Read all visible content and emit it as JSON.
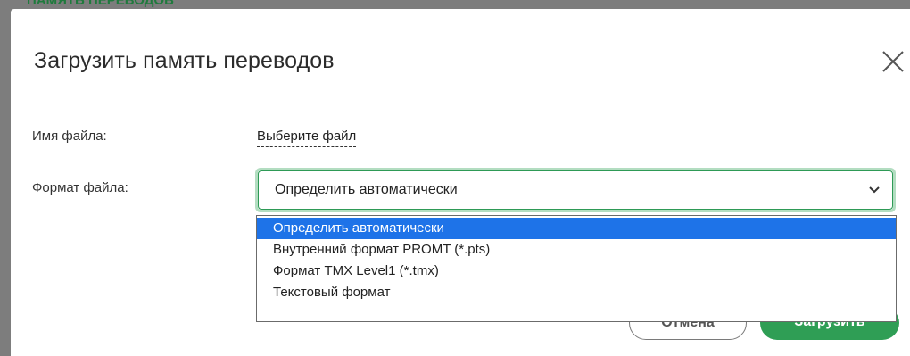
{
  "background": {
    "heading": "ПАМЯТЬ ПЕРЕВОДОВ"
  },
  "dialog": {
    "title": "Загрузить память переводов",
    "close_icon": "close-icon",
    "file_name_label": "Имя файла:",
    "file_link_text": "Выберите файл",
    "format_label": "Формат файла:",
    "format_select": {
      "value": "Определить автоматически",
      "chevron_icon": "chevron-down-icon"
    },
    "format_options": [
      {
        "label": "Определить автоматически",
        "selected": true
      },
      {
        "label": "Внутренний формат PROMT (*.pts)",
        "selected": false
      },
      {
        "label": "Формат TMX Level1 (*.tmx)",
        "selected": false
      },
      {
        "label": "Текстовый формат",
        "selected": false
      }
    ],
    "buttons": {
      "cancel": "Отмена",
      "upload": "Загрузить"
    }
  },
  "colors": {
    "accent": "#2f9e55",
    "selected_option": "#1e73e8",
    "backdrop": "#7d7d7d"
  }
}
